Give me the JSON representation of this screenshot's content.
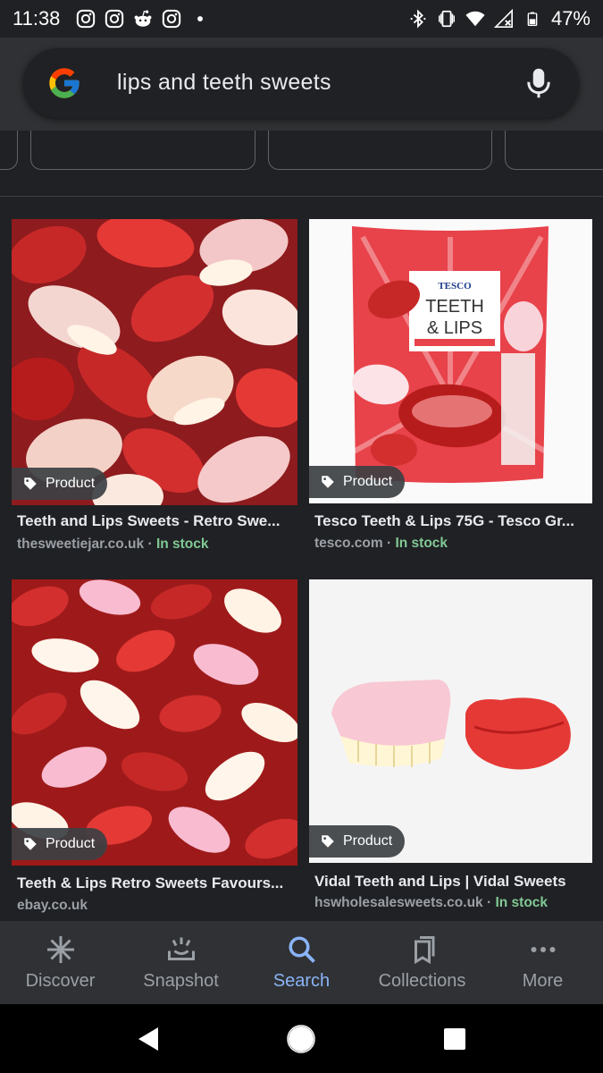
{
  "status_bar": {
    "time": "11:38",
    "battery": "47%",
    "icons": [
      "instagram-icon",
      "instagram-icon",
      "reddit-icon",
      "instagram-icon",
      "dot-icon",
      "bluetooth-icon",
      "vibrate-icon",
      "wifi-icon",
      "signal-icon",
      "battery-icon"
    ]
  },
  "search": {
    "query": "lips and teeth sweets",
    "logo": "google-g-logo",
    "mic": "mic-icon"
  },
  "results": [
    {
      "badge": "Product",
      "title": "Teeth and Lips Sweets - Retro Swe...",
      "source": "thesweetiejar.co.uk",
      "separator": " · ",
      "stock": "In stock"
    },
    {
      "badge": "Product",
      "title": "Tesco Teeth & Lips 75G - Tesco Gr...",
      "source": "tesco.com",
      "separator": " · ",
      "stock": "In stock",
      "package_brand": "TESCO",
      "package_name_line1": "TEETH",
      "package_name_line2": "& LIPS"
    },
    {
      "badge": "Product",
      "title": "Teeth & Lips Retro Sweets Favours...",
      "source": "ebay.co.uk"
    },
    {
      "badge": "Product",
      "title": "Vidal Teeth and Lips | Vidal Sweets",
      "source": "hswholesalesweets.co.uk",
      "separator": " · ",
      "stock": "In stock"
    }
  ],
  "bottom_nav": [
    {
      "label": "Discover",
      "icon": "asterisk-icon"
    },
    {
      "label": "Snapshot",
      "icon": "snapshot-icon"
    },
    {
      "label": "Search",
      "icon": "search-icon",
      "active": true
    },
    {
      "label": "Collections",
      "icon": "collections-icon"
    },
    {
      "label": "More",
      "icon": "more-dots-icon"
    }
  ],
  "colors": {
    "background": "#202124",
    "header": "#303134",
    "accent": "#8ab4f8",
    "in_stock": "#81c995"
  }
}
